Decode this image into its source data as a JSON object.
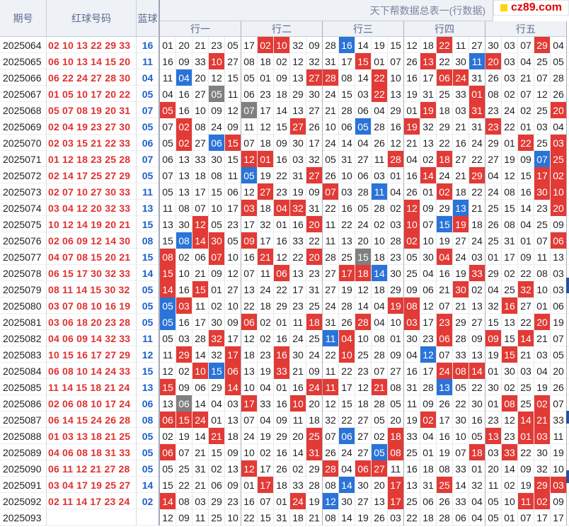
{
  "header": {
    "issue_label": "期号",
    "red_label": "红球号码",
    "blue_label": "蓝球",
    "title": "天下帮数据总表一(行数据)",
    "groups": [
      "行一",
      "行二",
      "行三",
      "行四",
      "行五"
    ],
    "logo_text": "cz89.com"
  },
  "rows": [
    {
      "issue": "2025064",
      "reds": "02 10 13 22 29 33",
      "blue": "16",
      "cells": "01 20 21 23 05 17 02 10 32 09 28 16 14 19 15 12 18 22 11 27 30 03 07 29 04",
      "marks": "00000 0RR00 0B000 00R00 000R0"
    },
    {
      "issue": "2025065",
      "reds": "06 10 13 14 15 20",
      "blue": "11",
      "cells": "16 09 33 10 27 08 18 02 12 32 31 17 15 01 07 26 13 22 30 11 20 03 04 25 05",
      "marks": "000R0 00000 00R00 0R00B R0000"
    },
    {
      "issue": "2025066",
      "reds": "06 22 24 27 28 30",
      "blue": "04",
      "cells": "11 04 20 12 15 05 01 09 13 27 28 08 14 22 10 16 17 06 24 31 26 03 21 07 28",
      "marks": "0B000 0000R R00R0 00RR0 00000"
    },
    {
      "issue": "2025067",
      "reds": "01 05 10 17 20 22",
      "blue": "05",
      "cells": "04 16 27 05 11 06 23 18 29 30 24 15 03 22 13 19 31 25 33 01 08 02 07 12 26",
      "marks": "000G0 00000 000R0 0000R 00000"
    },
    {
      "issue": "2025068",
      "reds": "05 07 08 19 20 31",
      "blue": "07",
      "cells": "05 16 10 09 12 07 17 14 13 27 21 28 06 04 29 01 19 18 03 31 23 24 02 25 20",
      "marks": "R0000 G0000 00000 0R00R 0000R"
    },
    {
      "issue": "2025069",
      "reds": "02 04 19 23 27 30",
      "blue": "05",
      "cells": "07 02 08 24 09 11 12 15 27 26 10 06 05 28 16 19 32 29 21 31 23 22 01 03 04",
      "marks": "0R000 000R0 00B00 R0000 R0000"
    },
    {
      "issue": "2025070",
      "reds": "02 03 15 21 22 33",
      "blue": "06",
      "cells": "05 02 27 06 15 07 18 09 30 17 24 14 04 26 12 21 13 22 16 24 29 01 22 25 03",
      "marks": "0R0BR 00000 00000 00000 00R0R"
    },
    {
      "issue": "2025071",
      "reds": "01 12 18 23 25 28",
      "blue": "07",
      "cells": "06 13 33 30 15 12 01 16 03 32 05 31 27 11 28 04 02 18 27 22 27 19 09 07 25",
      "marks": "00000 RR000 0000R 00R00 000BR"
    },
    {
      "issue": "2025072",
      "reds": "02 14 17 25 27 29",
      "blue": "05",
      "cells": "07 13 18 08 11 05 19 22 31 27 26 10 06 03 01 16 14 24 21 29 04 12 15 17 02",
      "marks": "00000 B000R 00000 0R00R 000RR"
    },
    {
      "issue": "2025073",
      "reds": "02 07 10 27 30 33",
      "blue": "11",
      "cells": "05 13 17 15 06 12 27 23 19 09 07 03 28 11 04 26 01 02 18 22 24 08 16 30 10",
      "marks": "00000 0R000 R00B0 00R00 000RR"
    },
    {
      "issue": "2025074",
      "reds": "03 04 12 20 32 33",
      "blue": "13",
      "cells": "11 08 07 10 17 03 18 04 32 31 22 16 05 28 02 12 09 29 13 21 25 15 14 23 20",
      "marks": "00000 R0RR0 00000 R00B0 0000R"
    },
    {
      "issue": "2025075",
      "reds": "10 12 14 19 20 21",
      "blue": "15",
      "cells": "13 30 12 05 23 17 32 01 16 20 11 22 24 02 03 10 07 15 19 18 26 08 04 25 09",
      "marks": "00R00 0000R 00000 R0BR0 00000"
    },
    {
      "issue": "2025076",
      "reds": "02 06 09 12 14 30",
      "blue": "08",
      "cells": "15 08 14 30 05 09 17 16 33 22 11 13 20 10 28 02 10 19 27 24 25 31 01 07 06",
      "marks": "0BRR0 R0000 00000 R0000 0000R"
    },
    {
      "issue": "2025077",
      "reds": "04 07 08 15 20 21",
      "blue": "15",
      "cells": "08 02 06 07 10 16 21 12 22 20 28 25 15 18 23 05 30 04 24 03 01 17 09 11 13",
      "marks": "R00R0 0R00R 00G00 00R00 00000"
    },
    {
      "issue": "2025078",
      "reds": "06 15 17 30 32 33",
      "blue": "14",
      "cells": "15 10 21 09 12 07 11 06 13 23 27 17 18 14 30 25 04 16 19 33 29 02 22 08 03",
      "marks": "R0000 00R00 0RRB0 0000R 00000"
    },
    {
      "issue": "2025079",
      "reds": "08 11 14 15 30 32",
      "blue": "05",
      "cells": "14 16 15 01 27 13 24 22 17 31 27 19 12 18 29 09 06 21 30 02 04 25 32 10 03",
      "marks": "R0R00 00000 00000 000R0 00R00"
    },
    {
      "issue": "2025080",
      "reds": "03 07 08 10 16 19",
      "blue": "05",
      "cells": "05 03 11 02 10 22 18 29 23 25 24 28 14 04 19 08 12 07 21 13 32 16 27 01 06",
      "marks": "BR000 00000 0000R R0000 0R000"
    },
    {
      "issue": "2025081",
      "reds": "03 06 18 20 23 28",
      "blue": "05",
      "cells": "05 16 17 30 09 06 02 01 11 18 31 26 28 04 10 03 17 23 29 27 15 13 22 20 19",
      "marks": "B0000 R000R 00R00 R0R00 000R0"
    },
    {
      "issue": "2025082",
      "reds": "04 06 09 14 32 33",
      "blue": "11",
      "cells": "05 03 28 32 17 12 02 16 24 25 11 04 10 08 01 30 23 06 28 09 09 15 14 21 07",
      "marks": "000R0 00000 BR000 00R00 R0R00"
    },
    {
      "issue": "2025083",
      "reds": "10 15 16 17 27 29",
      "blue": "12",
      "cells": "11 29 14 32 17 18 23 16 30 24 22 10 25 28 09 04 12 07 33 13 19 15 21 03 05",
      "marks": "0R00R 00R00 0R000 0B000 0R000"
    },
    {
      "issue": "2025084",
      "reds": "06 08 10 14 24 33",
      "blue": "15",
      "cells": "12 02 10 15 06 13 19 33 21 09 11 22 23 07 27 16 17 24 08 14 01 30 03 04 20",
      "marks": "00RBR 00R00 00000 00RRR 00000"
    },
    {
      "issue": "2025085",
      "reds": "11 14 15 18 21 24",
      "blue": "13",
      "cells": "15 09 06 29 14 10 04 01 16 24 11 17 12 21 08 31 28 13 05 22 30 02 25 19 26",
      "marks": "R000R 0000R R00R0 00B00 00000"
    },
    {
      "issue": "2025086",
      "reds": "02 06 08 10 17 24",
      "blue": "06",
      "cells": "13 06 14 04 03 17 33 16 10 20 12 15 18 28 05 11 09 26 22 30 01 08 25 02 07",
      "marks": "0G000 R00R0 00000 00000 0R0R0"
    },
    {
      "issue": "2025087",
      "reds": "06 14 15 24 26 28",
      "blue": "08",
      "cells": "06 15 24 01 13 07 04 09 11 18 32 22 27 05 20 19 02 17 30 16 23 12 14 21 33",
      "marks": "RRR00 00000 00000 0R000 00RR0"
    },
    {
      "issue": "2025088",
      "reds": "01 03 13 18 21 25",
      "blue": "05",
      "cells": "02 19 14 21 18 24 19 29 20 25 07 06 27 02 18 33 04 16 10 05 13 23 01 03 11",
      "marks": "000R0 0000R 0B00R 00000 R0RR0"
    },
    {
      "issue": "2025089",
      "reds": "04 06 08 18 31 33",
      "blue": "05",
      "cells": "06 07 21 15 09 10 02 16 14 31 26 24 27 05 08 25 01 19 07 18 03 33 22 30 19",
      "marks": "R0000 0000R 000BR 0000R 0R000"
    },
    {
      "issue": "2025090",
      "reds": "06 11 12 21 27 28",
      "blue": "05",
      "cells": "05 25 31 02 13 12 17 26 02 29 28 04 06 27 11 16 18 08 33 01 20 14 09 32 10",
      "marks": "00000 R0000 R0RR0 00000 00000"
    },
    {
      "issue": "2025091",
      "reds": "03 04 17 19 25 27",
      "blue": "14",
      "cells": "15 22 21 06 09 01 17 18 33 28 08 14 30 20 17 13 31 25 14 32 11 02 19 29 03",
      "marks": "00000 0R000 0B00R 00R00 000RR"
    },
    {
      "issue": "2025092",
      "reds": "02 11 14 17 23 24",
      "blue": "02",
      "cells": "14 08 03 29 23 16 07 01 24 19 12 30 27 13 17 25 06 26 33 04 05 10 11 02 09",
      "marks": "R0000 000R0 B000R 00000 00RR0"
    },
    {
      "issue": "2025093",
      "reds": "",
      "blue": "",
      "cells": "12 09 11 25 10 22 15 31 18 21 08 14 19 26 03 22 18 28 06 04 05 01 07 17 17",
      "marks": "00000 00000 00000 00000 00000"
    }
  ]
}
